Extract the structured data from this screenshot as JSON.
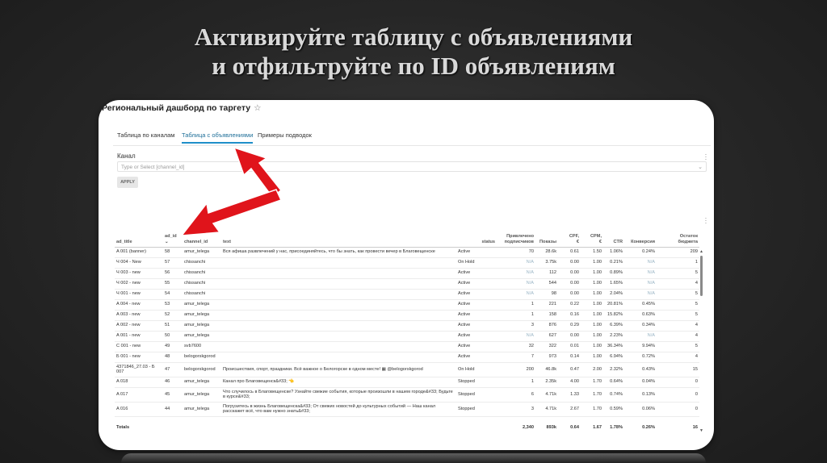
{
  "slide": {
    "title_line1": "Активируйте таблицу с объявлениями",
    "title_line2": "и отфильтруйте по ID объявлениям"
  },
  "dashboard": {
    "title": "Региональный дашборд по таргету",
    "tabs": [
      {
        "label": "Таблица по каналам",
        "active": false
      },
      {
        "label": "Таблица с объявлениями",
        "active": true
      },
      {
        "label": "Примеры подводок",
        "active": false
      }
    ],
    "filter": {
      "label": "Канал",
      "placeholder": "Type or Select [channel_id]",
      "apply_label": "APPLY"
    }
  },
  "table": {
    "headers": {
      "ad_title": "ad_title",
      "ad_id": "ad_id",
      "channel_id": "channel_id",
      "text": "text",
      "status": "status",
      "attracted_1": "Привлечено",
      "attracted_2": "подписчиков",
      "impressions": "Показы",
      "cpf_1": "CPF,",
      "cpf_2": "€",
      "cpm_1": "CPM,",
      "cpm_2": "€",
      "ctr": "CTR",
      "conversion": "Конверсия",
      "budget_1": "Остаток",
      "budget_2": "бюджета"
    },
    "rows": [
      {
        "ad_title": "A 001 (banner)",
        "ad_id": "58",
        "channel_id": "amur_telega",
        "text": "Вся афиша развлечений у нас, присоединяйтесь, что бы знать, как провести вечер в Благовещенске",
        "status": "Active",
        "attracted": "70",
        "impressions": "28.6k",
        "cpf": "0.61",
        "cpm": "1.50",
        "ctr": "1.06%",
        "conversion": "0.24%",
        "budget": "209"
      },
      {
        "ad_title": "Ч 004 - New",
        "ad_id": "57",
        "channel_id": "chissanchi",
        "text": "",
        "status": "On Hold",
        "attracted": "N/A",
        "impressions": "3.75k",
        "cpf": "0.00",
        "cpm": "1.00",
        "ctr": "0.21%",
        "conversion": "N/A",
        "budget": "1"
      },
      {
        "ad_title": "Ч 003 - new",
        "ad_id": "56",
        "channel_id": "chissanchi",
        "text": "",
        "status": "Active",
        "attracted": "N/A",
        "impressions": "112",
        "cpf": "0.00",
        "cpm": "1.00",
        "ctr": "0.89%",
        "conversion": "N/A",
        "budget": "5"
      },
      {
        "ad_title": "Ч 002 - new",
        "ad_id": "55",
        "channel_id": "chissanchi",
        "text": "",
        "status": "Active",
        "attracted": "N/A",
        "impressions": "544",
        "cpf": "0.00",
        "cpm": "1.00",
        "ctr": "1.65%",
        "conversion": "N/A",
        "budget": "4"
      },
      {
        "ad_title": "Ч 001 - new",
        "ad_id": "54",
        "channel_id": "chissanchi",
        "text": "",
        "status": "Active",
        "attracted": "N/A",
        "impressions": "98",
        "cpf": "0.00",
        "cpm": "1.00",
        "ctr": "2.04%",
        "conversion": "N/A",
        "budget": "5"
      },
      {
        "ad_title": "A 004 - new",
        "ad_id": "53",
        "channel_id": "amur_telega",
        "text": "",
        "status": "Active",
        "attracted": "1",
        "impressions": "221",
        "cpf": "0.22",
        "cpm": "1.00",
        "ctr": "20.81%",
        "conversion": "0.45%",
        "budget": "5"
      },
      {
        "ad_title": "A 003 - new",
        "ad_id": "52",
        "channel_id": "amur_telega",
        "text": "",
        "status": "Active",
        "attracted": "1",
        "impressions": "158",
        "cpf": "0.16",
        "cpm": "1.00",
        "ctr": "15.82%",
        "conversion": "0.63%",
        "budget": "5"
      },
      {
        "ad_title": "A 002 - new",
        "ad_id": "51",
        "channel_id": "amur_telega",
        "text": "",
        "status": "Active",
        "attracted": "3",
        "impressions": "876",
        "cpf": "0.29",
        "cpm": "1.00",
        "ctr": "6.39%",
        "conversion": "0.34%",
        "budget": "4"
      },
      {
        "ad_title": "A 001 - new",
        "ad_id": "50",
        "channel_id": "amur_telega",
        "text": "",
        "status": "Active",
        "attracted": "N/A",
        "impressions": "627",
        "cpf": "0.00",
        "cpm": "1.00",
        "ctr": "2.23%",
        "conversion": "N/A",
        "budget": "4"
      },
      {
        "ad_title": "С 001 - new",
        "ad_id": "49",
        "channel_id": "svb7600",
        "text": "",
        "status": "Active",
        "attracted": "32",
        "impressions": "322",
        "cpf": "0.01",
        "cpm": "1.00",
        "ctr": "36.34%",
        "conversion": "9.94%",
        "budget": "5"
      },
      {
        "ad_title": "Б 001 - new",
        "ad_id": "48",
        "channel_id": "belogorskgorod",
        "text": "",
        "status": "Active",
        "attracted": "7",
        "impressions": "973",
        "cpf": "0.14",
        "cpm": "1.00",
        "ctr": "6.94%",
        "conversion": "0.72%",
        "budget": "4"
      },
      {
        "ad_title": "4371846_27.03 - Б 007",
        "ad_id": "47",
        "channel_id": "belogorskgorod",
        "text": "Происшествия, спорт, праздники. Всё важное о Белогорске в одном месте! ▦ @belogorskgorod",
        "status": "On Hold",
        "attracted": "200",
        "impressions": "46.8k",
        "cpf": "0.47",
        "cpm": "2.00",
        "ctr": "2.32%",
        "conversion": "0.43%",
        "budget": "15",
        "tall": true
      },
      {
        "ad_title": "A 018",
        "ad_id": "46",
        "channel_id": "amur_telega",
        "text": "Канал про Благовещенск&#33; 👈",
        "status": "Stopped",
        "attracted": "1",
        "impressions": "2.35k",
        "cpf": "4.00",
        "cpm": "1.70",
        "ctr": "0.64%",
        "conversion": "0.04%",
        "budget": "0"
      },
      {
        "ad_title": "A 017",
        "ad_id": "45",
        "channel_id": "amur_telega",
        "text": "Что случилось в Благовещенске? Узнайте свежие события, которые произошли в нашем городе&#33; Будьте в курсе&#33;",
        "status": "Stopped",
        "attracted": "6",
        "impressions": "4.71k",
        "cpf": "1.33",
        "cpm": "1.70",
        "ctr": "0.74%",
        "conversion": "0.13%",
        "budget": "0",
        "tall": true
      },
      {
        "ad_title": "A 016",
        "ad_id": "44",
        "channel_id": "amur_telega",
        "text": "Погрузитесь в жизнь Благовещенска&#33; От свежих новостей до культурных событий — Наш канал расскажет всё, что вам нужно знать&#33;",
        "status": "Stopped",
        "attracted": "3",
        "impressions": "4.71k",
        "cpf": "2.67",
        "cpm": "1.70",
        "ctr": "0.59%",
        "conversion": "0.06%",
        "budget": "0",
        "tall": true
      }
    ],
    "totals": {
      "label": "Totals",
      "attracted": "2,340",
      "impressions": "893k",
      "cpf": "0.64",
      "cpm": "1.67",
      "ctr": "1.78%",
      "conversion": "0.26%",
      "budget": "16"
    }
  },
  "colors": {
    "arrow": "#e0141b",
    "accent": "#1f8fc9",
    "na": "#9bb6c6"
  }
}
